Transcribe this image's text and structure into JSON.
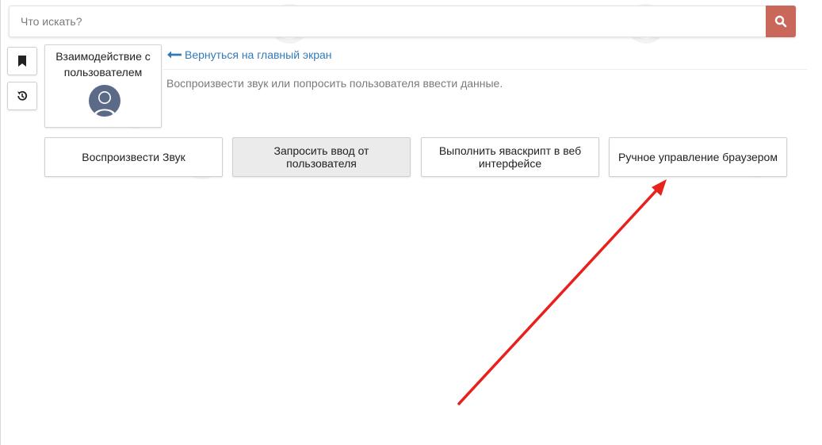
{
  "search": {
    "placeholder": "Что искать?",
    "button_icon": "search-icon"
  },
  "sidebar": {
    "buttons": [
      {
        "icon": "bookmark-icon"
      },
      {
        "icon": "history-icon"
      }
    ]
  },
  "category": {
    "title": "Взаимодействие с пользователем",
    "icon": "user-avatar-icon"
  },
  "nav": {
    "back_label": "Вернуться на главный экран",
    "back_icon": "arrow-left-icon"
  },
  "description": "Воспроизвести звук или попросить пользователя ввести данные.",
  "actions": [
    {
      "label": "Воспроизвести Звук",
      "active": false
    },
    {
      "label": "Запросить ввод от пользователя",
      "active": true
    },
    {
      "label": "Выполнить яваскрипт в веб интерфейсе",
      "active": false
    },
    {
      "label": "Ручное управление браузером",
      "active": false
    }
  ],
  "colors": {
    "search_button": "#c9675b",
    "link": "#337ab7",
    "annotation_arrow": "#e8211f",
    "avatar": "#5b6a86"
  }
}
